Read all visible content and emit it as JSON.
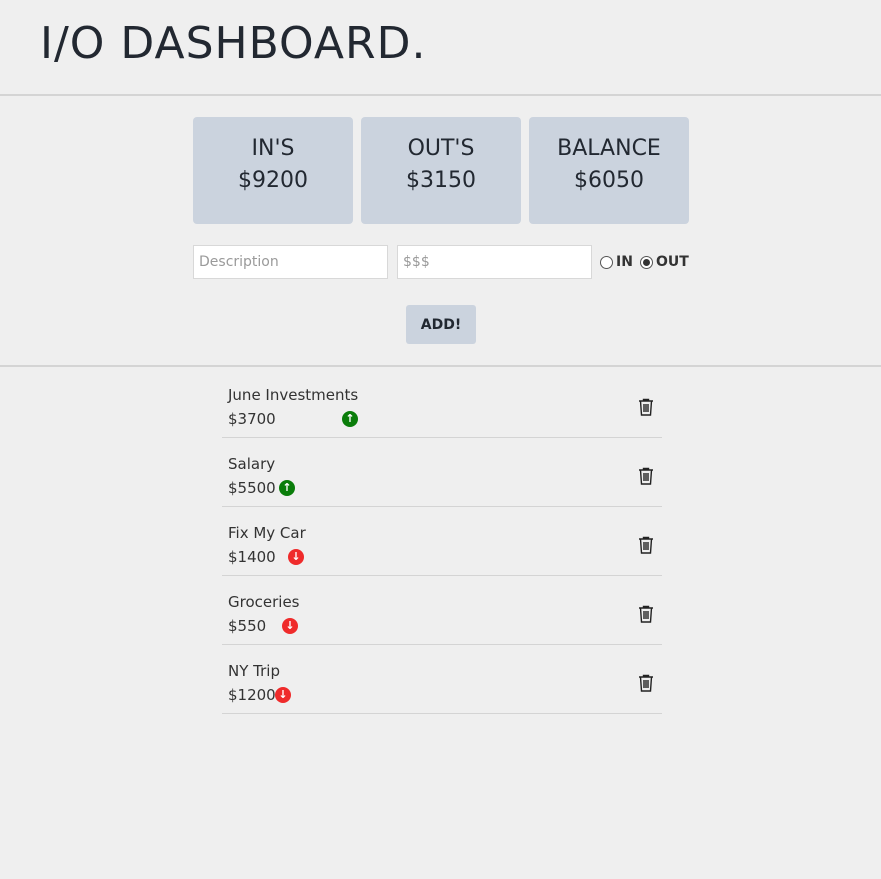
{
  "header": {
    "title": "I/O DASHBOARD."
  },
  "cards": [
    {
      "label": "IN'S",
      "value": "$9200"
    },
    {
      "label": "OUT'S",
      "value": "$3150"
    },
    {
      "label": "BALANCE",
      "value": "$6050"
    }
  ],
  "form": {
    "description_placeholder": "Description",
    "amount_placeholder": "$$$",
    "description_value": "",
    "amount_value": "",
    "radio_in_label": "IN",
    "radio_out_label": "OUT",
    "selected_type": "OUT",
    "add_label": "ADD!"
  },
  "transactions": [
    {
      "description": "June Investments",
      "amount": "$3700",
      "type": "in",
      "icon": "arrow-up-icon"
    },
    {
      "description": "Salary",
      "amount": "$5500",
      "type": "in",
      "icon": "arrow-up-icon"
    },
    {
      "description": "Fix My Car",
      "amount": "$1400",
      "type": "out",
      "icon": "arrow-down-icon"
    },
    {
      "description": "Groceries",
      "amount": "$550",
      "type": "out",
      "icon": "arrow-down-icon"
    },
    {
      "description": "NY Trip",
      "amount": "$1200",
      "type": "out",
      "icon": "arrow-down-icon"
    }
  ],
  "colors": {
    "background": "#efefef",
    "card": "#cbd3de",
    "in_arrow": "#0a7d0a",
    "out_arrow": "#ef2b2b",
    "text": "#222831"
  }
}
